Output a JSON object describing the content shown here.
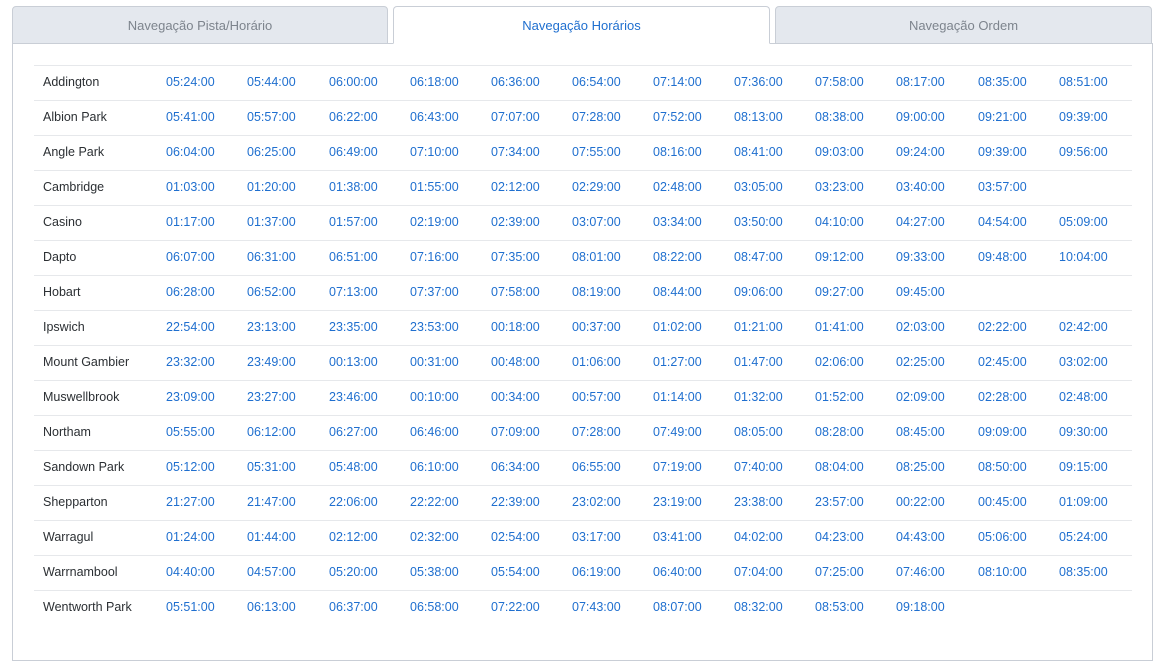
{
  "tabs": [
    {
      "label": "Navegação Pista/Horário",
      "active": false
    },
    {
      "label": "Navegação Horários",
      "active": true
    },
    {
      "label": "Navegação Ordem",
      "active": false
    }
  ],
  "colors": {
    "accent": "#1f6fcf",
    "tab_inactive_bg": "#e4e8ee",
    "border": "#c9ced6"
  },
  "rows": [
    {
      "track": "Addington",
      "times": [
        "05:24:00",
        "05:44:00",
        "06:00:00",
        "06:18:00",
        "06:36:00",
        "06:54:00",
        "07:14:00",
        "07:36:00",
        "07:58:00",
        "08:17:00",
        "08:35:00",
        "08:51:00"
      ]
    },
    {
      "track": "Albion Park",
      "times": [
        "05:41:00",
        "05:57:00",
        "06:22:00",
        "06:43:00",
        "07:07:00",
        "07:28:00",
        "07:52:00",
        "08:13:00",
        "08:38:00",
        "09:00:00",
        "09:21:00",
        "09:39:00"
      ]
    },
    {
      "track": "Angle Park",
      "times": [
        "06:04:00",
        "06:25:00",
        "06:49:00",
        "07:10:00",
        "07:34:00",
        "07:55:00",
        "08:16:00",
        "08:41:00",
        "09:03:00",
        "09:24:00",
        "09:39:00",
        "09:56:00"
      ]
    },
    {
      "track": "Cambridge",
      "times": [
        "01:03:00",
        "01:20:00",
        "01:38:00",
        "01:55:00",
        "02:12:00",
        "02:29:00",
        "02:48:00",
        "03:05:00",
        "03:23:00",
        "03:40:00",
        "03:57:00"
      ]
    },
    {
      "track": "Casino",
      "times": [
        "01:17:00",
        "01:37:00",
        "01:57:00",
        "02:19:00",
        "02:39:00",
        "03:07:00",
        "03:34:00",
        "03:50:00",
        "04:10:00",
        "04:27:00",
        "04:54:00",
        "05:09:00"
      ]
    },
    {
      "track": "Dapto",
      "times": [
        "06:07:00",
        "06:31:00",
        "06:51:00",
        "07:16:00",
        "07:35:00",
        "08:01:00",
        "08:22:00",
        "08:47:00",
        "09:12:00",
        "09:33:00",
        "09:48:00",
        "10:04:00"
      ]
    },
    {
      "track": "Hobart",
      "times": [
        "06:28:00",
        "06:52:00",
        "07:13:00",
        "07:37:00",
        "07:58:00",
        "08:19:00",
        "08:44:00",
        "09:06:00",
        "09:27:00",
        "09:45:00"
      ]
    },
    {
      "track": "Ipswich",
      "times": [
        "22:54:00",
        "23:13:00",
        "23:35:00",
        "23:53:00",
        "00:18:00",
        "00:37:00",
        "01:02:00",
        "01:21:00",
        "01:41:00",
        "02:03:00",
        "02:22:00",
        "02:42:00"
      ]
    },
    {
      "track": "Mount Gambier",
      "times": [
        "23:32:00",
        "23:49:00",
        "00:13:00",
        "00:31:00",
        "00:48:00",
        "01:06:00",
        "01:27:00",
        "01:47:00",
        "02:06:00",
        "02:25:00",
        "02:45:00",
        "03:02:00"
      ]
    },
    {
      "track": "Muswellbrook",
      "times": [
        "23:09:00",
        "23:27:00",
        "23:46:00",
        "00:10:00",
        "00:34:00",
        "00:57:00",
        "01:14:00",
        "01:32:00",
        "01:52:00",
        "02:09:00",
        "02:28:00",
        "02:48:00"
      ]
    },
    {
      "track": "Northam",
      "times": [
        "05:55:00",
        "06:12:00",
        "06:27:00",
        "06:46:00",
        "07:09:00",
        "07:28:00",
        "07:49:00",
        "08:05:00",
        "08:28:00",
        "08:45:00",
        "09:09:00",
        "09:30:00"
      ]
    },
    {
      "track": "Sandown Park",
      "times": [
        "05:12:00",
        "05:31:00",
        "05:48:00",
        "06:10:00",
        "06:34:00",
        "06:55:00",
        "07:19:00",
        "07:40:00",
        "08:04:00",
        "08:25:00",
        "08:50:00",
        "09:15:00"
      ]
    },
    {
      "track": "Shepparton",
      "times": [
        "21:27:00",
        "21:47:00",
        "22:06:00",
        "22:22:00",
        "22:39:00",
        "23:02:00",
        "23:19:00",
        "23:38:00",
        "23:57:00",
        "00:22:00",
        "00:45:00",
        "01:09:00"
      ]
    },
    {
      "track": "Warragul",
      "times": [
        "01:24:00",
        "01:44:00",
        "02:12:00",
        "02:32:00",
        "02:54:00",
        "03:17:00",
        "03:41:00",
        "04:02:00",
        "04:23:00",
        "04:43:00",
        "05:06:00",
        "05:24:00"
      ]
    },
    {
      "track": "Warrnambool",
      "times": [
        "04:40:00",
        "04:57:00",
        "05:20:00",
        "05:38:00",
        "05:54:00",
        "06:19:00",
        "06:40:00",
        "07:04:00",
        "07:25:00",
        "07:46:00",
        "08:10:00",
        "08:35:00"
      ]
    },
    {
      "track": "Wentworth Park",
      "times": [
        "05:51:00",
        "06:13:00",
        "06:37:00",
        "06:58:00",
        "07:22:00",
        "07:43:00",
        "08:07:00",
        "08:32:00",
        "08:53:00",
        "09:18:00"
      ]
    }
  ]
}
